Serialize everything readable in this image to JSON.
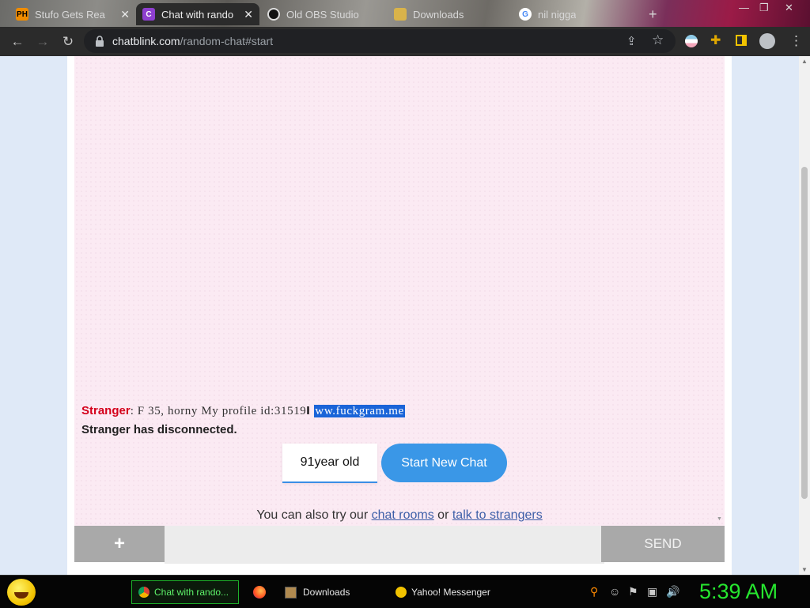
{
  "browser": {
    "tabs": [
      {
        "title": "Stufo Gets Rea",
        "favicon": "PH",
        "active": false
      },
      {
        "title": "Chat with rando",
        "favicon": "C",
        "active": true
      },
      {
        "title": "Old OBS Studio",
        "favicon": "",
        "active": false
      },
      {
        "title": "Downloads",
        "favicon": "",
        "active": false
      },
      {
        "title": "nil nigga",
        "favicon": "G",
        "active": false
      }
    ],
    "new_tab": "+",
    "url_host": "chatblink.com",
    "url_path": "/random-chat#start"
  },
  "chat": {
    "stranger_label": "Stranger",
    "message_text": ": F 35, horny My profile id:31519",
    "message_selected": "ww.fuckgram.me",
    "disconnected": "Stranger has disconnected.",
    "age_value": "91year old",
    "start_button": "Start New Chat",
    "also_prefix": "You can also try our ",
    "link_chat_rooms": "chat rooms",
    "also_or": " or ",
    "link_talk": "talk to strangers",
    "plus_label": "+",
    "send_label": "SEND"
  },
  "taskbar": {
    "tasks": [
      {
        "label": "Chat with rando...",
        "icon": "chrome-icon",
        "active": true
      },
      {
        "label": "",
        "icon": "firefox-icon",
        "active": false
      },
      {
        "label": "Downloads",
        "icon": "folder-icon",
        "active": false
      },
      {
        "label": "Yahoo! Messenger",
        "icon": "yahoo-messenger-icon",
        "active": false
      }
    ],
    "clock": "5:39 AM"
  }
}
